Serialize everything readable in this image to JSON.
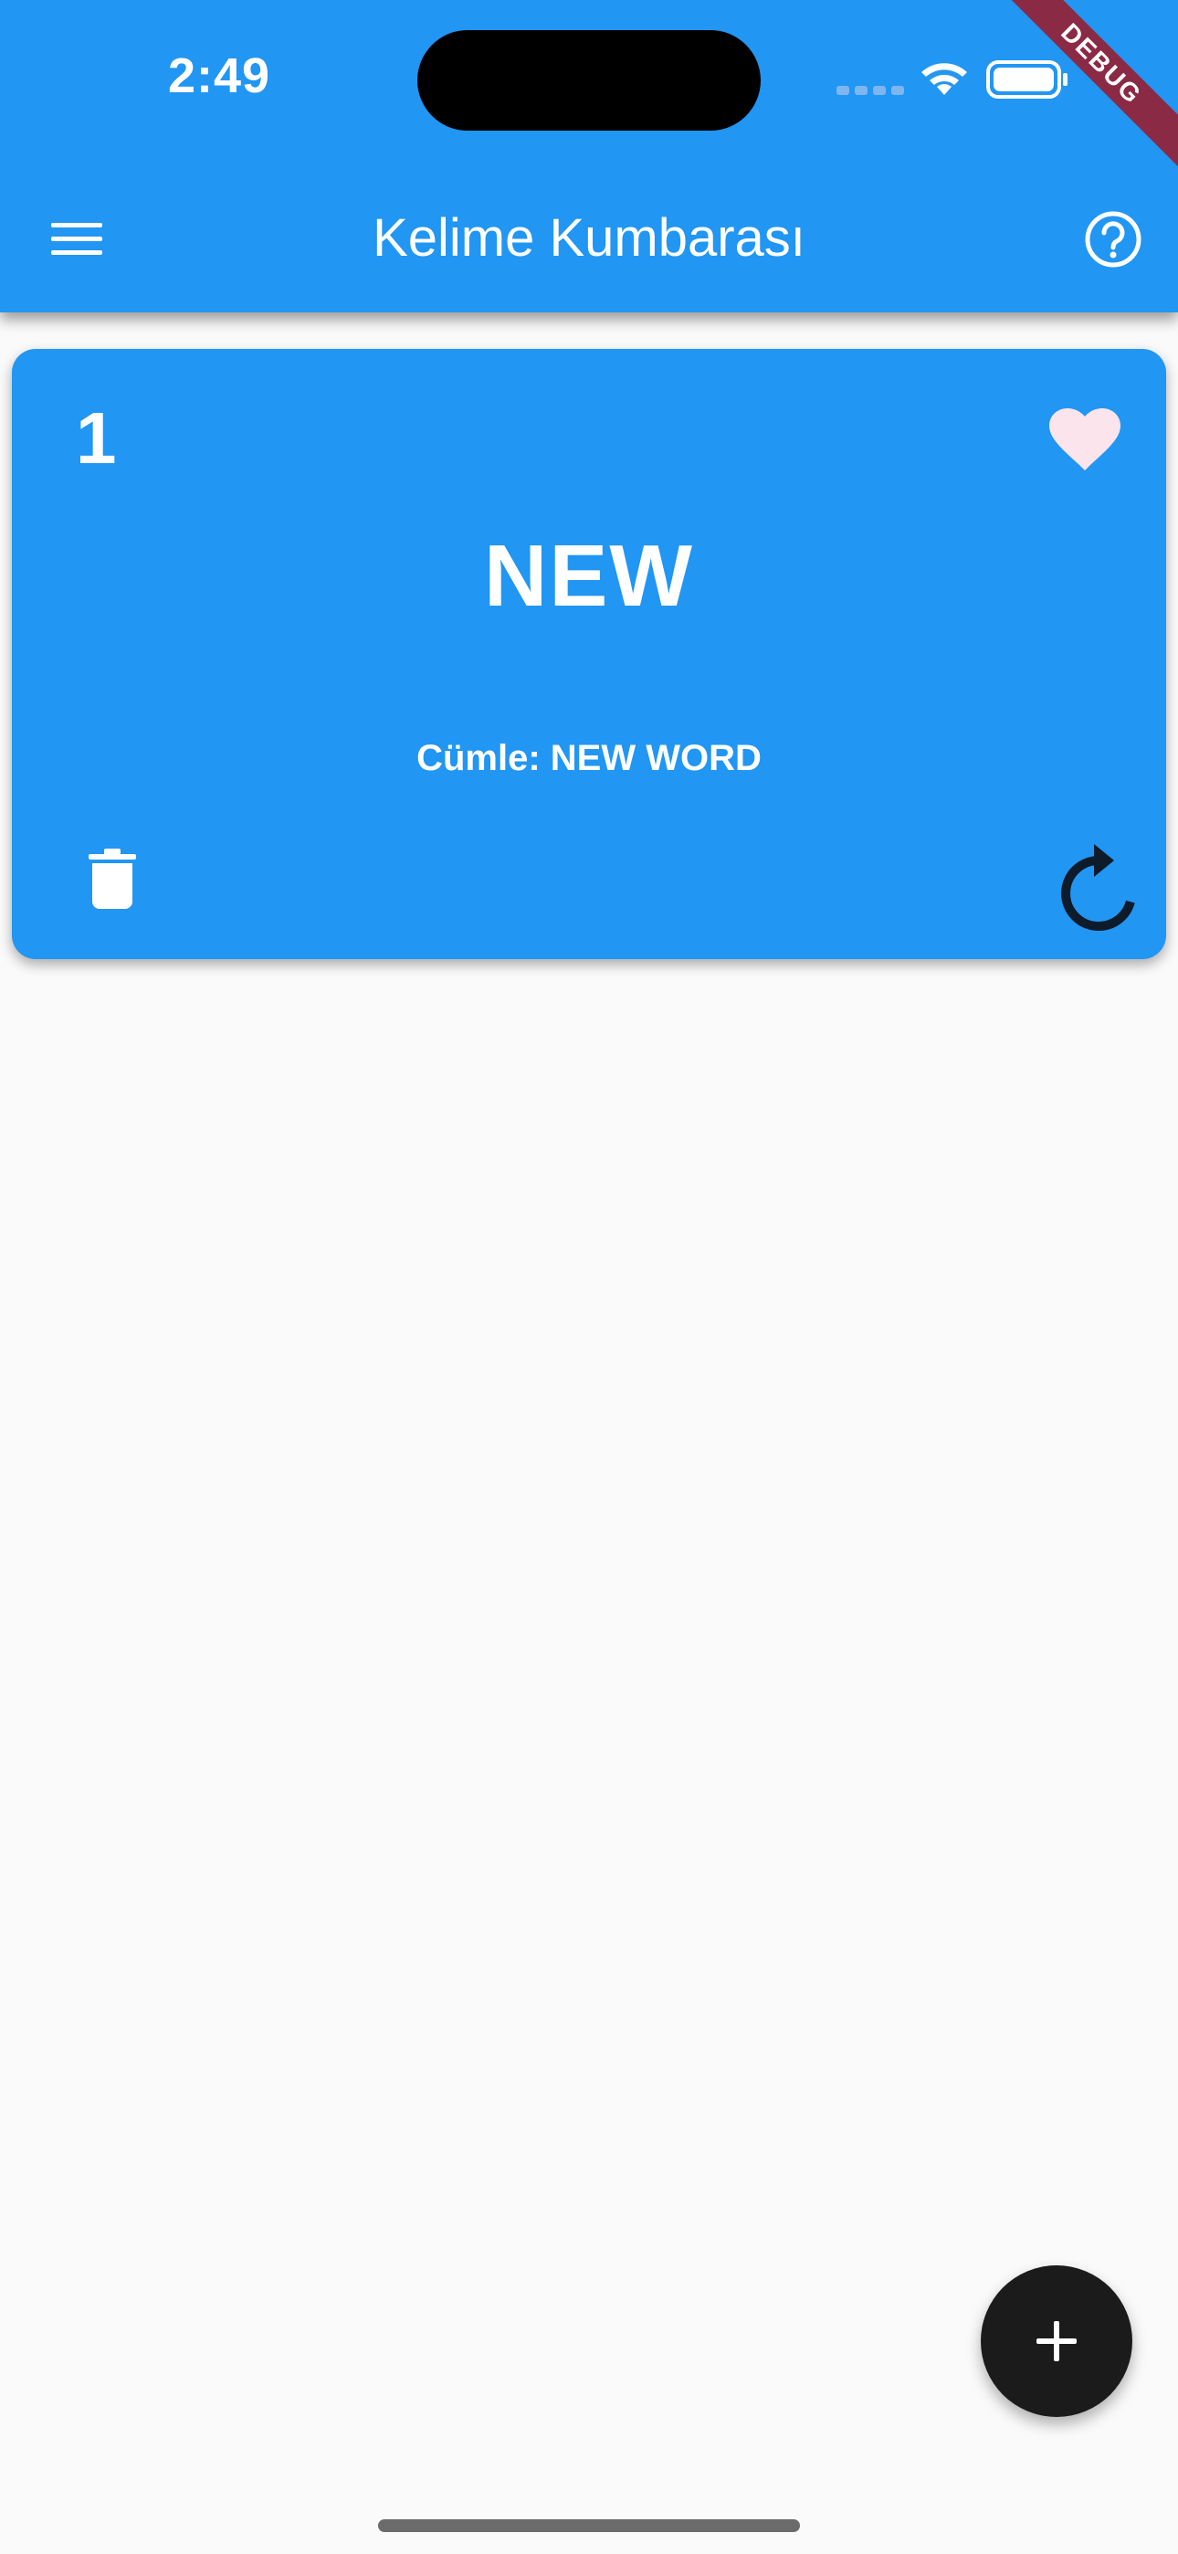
{
  "status_bar": {
    "time": "2:49"
  },
  "debug_banner": "DEBUG",
  "app_bar": {
    "title": "Kelime Kumbarası",
    "menu_icon": "hamburger-menu-icon",
    "help_icon": "help-circle-icon",
    "background": "#2196f3"
  },
  "cards": [
    {
      "index": "1",
      "word": "NEW",
      "sentence": "Cümle: NEW WORD",
      "favorite_icon": "heart-icon",
      "delete_icon": "trash-icon",
      "repeat_icon": "refresh-icon",
      "background": "#2196f3"
    }
  ],
  "fab": {
    "icon": "plus-icon",
    "background": "#1b1b1b"
  }
}
